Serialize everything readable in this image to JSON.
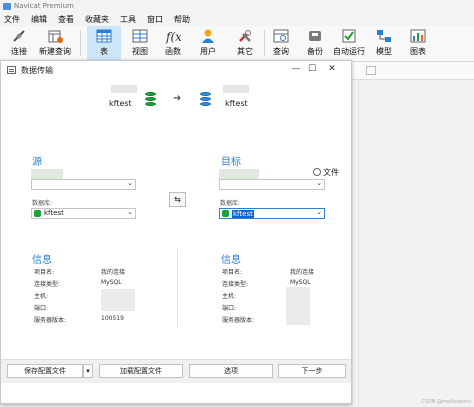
{
  "app": {
    "title": "Navicat Premium"
  },
  "menu": [
    "文件",
    "编辑",
    "查看",
    "收藏夹",
    "工具",
    "窗口",
    "帮助"
  ],
  "toolbar": {
    "connect": "连接",
    "new_query": "新建查询",
    "table": "表",
    "view": "视图",
    "function": "函数",
    "user": "用户",
    "other": "其它",
    "query": "查询",
    "backup": "备份",
    "automation": "自动运行",
    "model": "模型",
    "chart": "图表"
  },
  "dialog": {
    "title": "数据传输",
    "source_db": "kftest",
    "target_db": "kftest",
    "source": {
      "heading": "源",
      "db_label": "数据库:",
      "db_value": "kftest"
    },
    "target": {
      "heading": "目标",
      "file_option": "文件",
      "db_label": "数据库:",
      "db_value": "kftest"
    },
    "info_left": {
      "heading": "信息",
      "rows": [
        {
          "label": "项目名:",
          "value": "我的连接"
        },
        {
          "label": "连接类型:",
          "value": "MySQL"
        },
        {
          "label": "主机:",
          "value": ""
        },
        {
          "label": "端口:",
          "value": ""
        },
        {
          "label": "服务器版本:",
          "value": "100519"
        }
      ]
    },
    "info_right": {
      "heading": "信息",
      "rows": [
        {
          "label": "项目名:",
          "value": "我的连接"
        },
        {
          "label": "连接类型:",
          "value": "MySQL"
        },
        {
          "label": "主机:",
          "value": ""
        },
        {
          "label": "端口:",
          "value": ""
        },
        {
          "label": "服务器版本:",
          "value": ""
        }
      ]
    },
    "buttons": {
      "save_profile": "保存配置文件",
      "load_profile": "加载配置文件",
      "options": "选项",
      "next": "下一步"
    }
  },
  "watermark": "CSDN @meihuaxinz",
  "colors": {
    "accent": "#2c7fd1",
    "db_green": "#1ea03b",
    "db_blue": "#2f8fe0",
    "selection": "#0a66d8"
  }
}
